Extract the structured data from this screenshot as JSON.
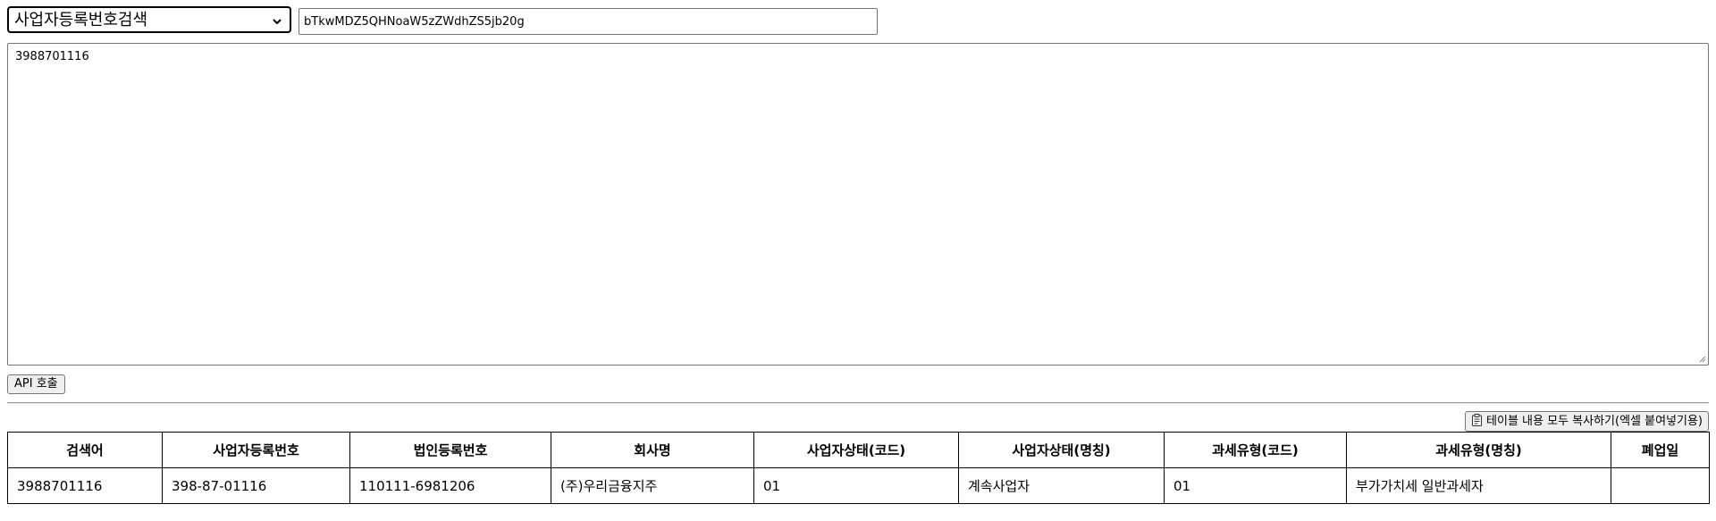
{
  "search": {
    "mode_selected": "사업자등록번호검색",
    "api_key_value": "bTkwMDZ5QHNoaW5zZWdhZS5jb20g",
    "query_value": "3988701116"
  },
  "actions": {
    "api_call_label": "API 호출",
    "copy_table_label": "테이블 내용 모두 복사하기(엑셀 붙여넣기용)"
  },
  "icons": {
    "select_arrow": "chevron-down-icon",
    "copy": "clipboard-icon",
    "resize": "resize-grip-icon"
  },
  "table": {
    "headers": [
      "검색어",
      "사업자등록번호",
      "법인등록번호",
      "회사명",
      "사업자상태(코드)",
      "사업자상태(명칭)",
      "과세유형(코드)",
      "과세유형(명칭)",
      "폐업일"
    ],
    "rows": [
      [
        "3988701116",
        "398-87-01116",
        "110111-6981206",
        "(주)우리금융지주",
        "01",
        "계속사업자",
        "01",
        "부가가치세 일반과세자",
        ""
      ]
    ]
  }
}
